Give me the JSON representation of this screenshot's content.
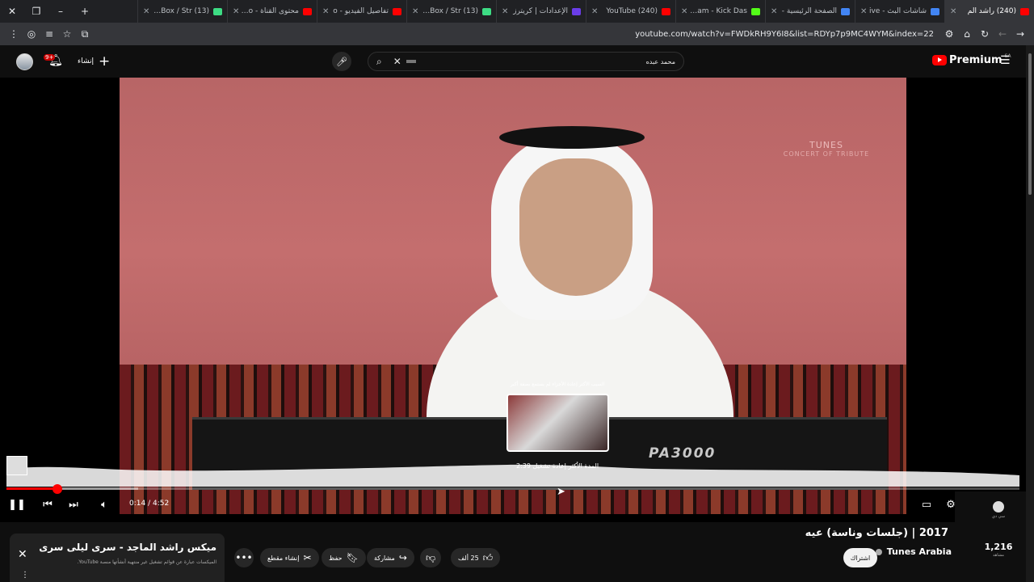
{
  "browser": {
    "tabs": [
      {
        "title": "(13) Alert Box / Str",
        "favicon_color": "#3ddc84",
        "active": false
      },
      {
        "title": "محتوى القناة - udio",
        "favicon_color": "#ff0000",
        "active": false
      },
      {
        "title": "تفاصيل الفيديو - o",
        "favicon_color": "#ff0000",
        "active": false
      },
      {
        "title": "(13) Alert Box / Str",
        "favicon_color": "#3ddc84",
        "active": false
      },
      {
        "title": "الإعدادات | كريترز",
        "favicon_color": "#6a3de8",
        "active": false
      },
      {
        "title": "(240) YouTube",
        "favicon_color": "#ff0000",
        "active": false
      },
      {
        "title": "Stream - Kick Das",
        "favicon_color": "#53fc18",
        "active": false
      },
      {
        "title": "الصفحة الرئيسية -",
        "favicon_color": "#4285f4",
        "active": false
      },
      {
        "title": "شاشات البث - ive",
        "favicon_color": "#4285f4",
        "active": false
      },
      {
        "title": "(240) راشد الم",
        "favicon_color": "#ff0000",
        "active": true
      }
    ],
    "new_tab_symbol": "+",
    "url": "youtube.com/watch?v=FWDkRH9Y6I8&list=RDYp7p9MC4WYM&index=22"
  },
  "header": {
    "search_query": "محمد عبده",
    "notification_count": "9+",
    "create_label": "إنشاء",
    "logo_text": "Premium",
    "region": "SA"
  },
  "player": {
    "time": "0:14 / 4:52",
    "played_fraction": 0.05,
    "buffered_fraction": 0.13,
    "preview_title": "السبب الأكثر إعادة الأجزاء لم يستمع بصفة أكبر",
    "preview_time": "2:39  المدة الأكثر إعادة تشغيل",
    "watermark_text": "TUNES",
    "watermark_subtext": "CONCERT OF TRIBUTE",
    "keyboard_brand": "PA3000"
  },
  "video": {
    "title": "2017 | (جلسات وناسة) عيه",
    "channel": "Tunes Arabia",
    "subscribe_label": "اشتراك",
    "like_count": "25 ألف",
    "share_label": "مشاركة",
    "save_label": "حفظ",
    "clip_label": "إنشاء مقطع"
  },
  "miniplayer": {
    "title": "ميكس راشد الماجد - سرى ليلى سرى",
    "subtitle": "الميكسات عبارة عن قوائم تشغيل غير منتهية أنشأتها منصة YouTube."
  },
  "right_rail": {
    "label": "سي دي",
    "count": "1,216",
    "sublabel": "مشاهد"
  }
}
